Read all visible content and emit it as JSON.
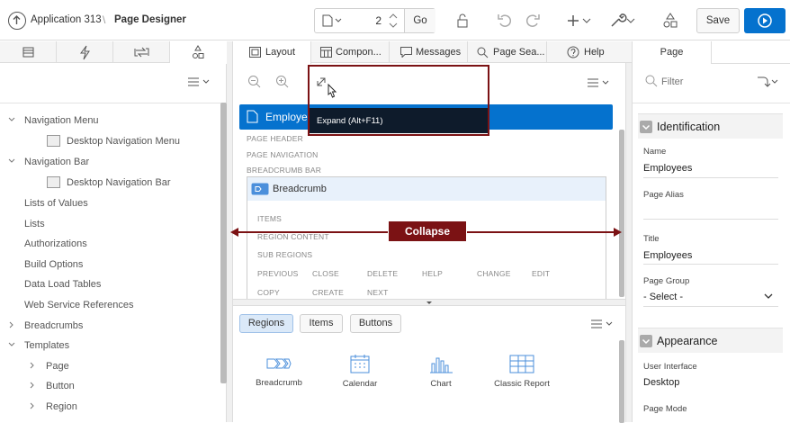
{
  "header": {
    "app_label": "Application 313",
    "separator": "\\",
    "page_designer": "Page Designer",
    "page_number": "2",
    "go_label": "Go",
    "save_label": "Save"
  },
  "left": {
    "tree": [
      {
        "label": "Navigation Menu",
        "type": "expanded"
      },
      {
        "label": "Desktop Navigation Menu",
        "type": "child"
      },
      {
        "label": "Navigation Bar",
        "type": "expanded"
      },
      {
        "label": "Desktop Navigation Bar",
        "type": "child"
      },
      {
        "label": "Lists of Values",
        "type": "leaf"
      },
      {
        "label": "Lists",
        "type": "leaf"
      },
      {
        "label": "Authorizations",
        "type": "leaf"
      },
      {
        "label": "Build Options",
        "type": "leaf"
      },
      {
        "label": "Data Load Tables",
        "type": "leaf"
      },
      {
        "label": "Web Service References",
        "type": "leaf"
      },
      {
        "label": "Breadcrumbs",
        "type": "collapsed"
      },
      {
        "label": "Templates",
        "type": "expanded"
      },
      {
        "label": "Page",
        "type": "sub"
      },
      {
        "label": "Button",
        "type": "sub"
      },
      {
        "label": "Region",
        "type": "sub"
      }
    ]
  },
  "center": {
    "tabs": [
      "Layout",
      "Compon...",
      "Messages",
      "Page Sea...",
      "Help"
    ],
    "tooltip": "Expand (Alt+F11)",
    "page_title": "Employee",
    "labels": {
      "page_header": "PAGE HEADER",
      "page_navigation": "PAGE NAVIGATION",
      "breadcrumb_bar": "BREADCRUMB BAR",
      "items": "ITEMS",
      "region_content": "REGION CONTENT",
      "sub_regions": "SUB REGIONS"
    },
    "breadcrumb_region": "Breadcrumb",
    "buttons_row1": [
      "PREVIOUS",
      "CLOSE",
      "DELETE",
      "HELP",
      "CHANGE",
      "EDIT"
    ],
    "buttons_row2": [
      "COPY",
      "CREATE",
      "NEXT"
    ],
    "callout": "Collapse",
    "gallery_tabs": [
      "Regions",
      "Items",
      "Buttons"
    ],
    "gallery": [
      "Breadcrumb",
      "Calendar",
      "Chart",
      "Classic Report"
    ]
  },
  "right": {
    "tab": "Page",
    "filter_placeholder": "Filter",
    "identification": "Identification",
    "name_label": "Name",
    "name_value": "Employees",
    "alias_label": "Page Alias",
    "alias_value": "",
    "title_label": "Title",
    "title_value": "Employees",
    "group_label": "Page Group",
    "group_value": "- Select -",
    "appearance": "Appearance",
    "ui_label": "User Interface",
    "ui_value": "Desktop",
    "mode_label": "Page Mode"
  },
  "colors": {
    "accent": "#0572ce",
    "callout": "#7b1214",
    "tooltip": "#0e1b2b"
  }
}
